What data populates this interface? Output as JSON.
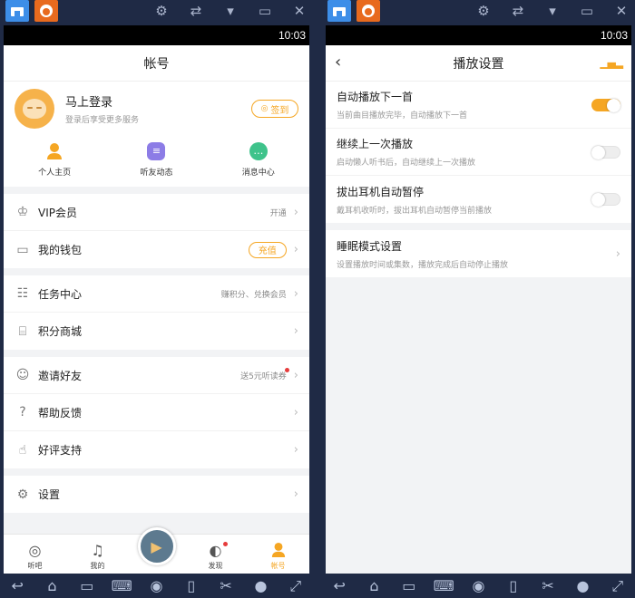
{
  "status_time": "10:03",
  "account": {
    "title": "帐号",
    "login_label": "马上登录",
    "login_sub": "登录后享受更多服务",
    "signin_label": "签到",
    "shortcuts": [
      {
        "label": "个人主页"
      },
      {
        "label": "听友动态"
      },
      {
        "label": "消息中心"
      }
    ],
    "menu": {
      "vip": {
        "label": "VIP会员",
        "value": "开通"
      },
      "wallet": {
        "label": "我的钱包",
        "pill": "充值"
      },
      "tasks": {
        "label": "任务中心",
        "value": "赚积分、兑换会员"
      },
      "points_mall": {
        "label": "积分商城"
      },
      "invite": {
        "label": "邀请好友",
        "value": "送5元听读券"
      },
      "help": {
        "label": "帮助反馈"
      },
      "rate": {
        "label": "好评支持"
      },
      "settings": {
        "label": "设置"
      }
    },
    "tabs": [
      {
        "label": "听吧"
      },
      {
        "label": "我的"
      },
      {
        "label": "发现"
      },
      {
        "label": "帐号"
      }
    ]
  },
  "playback": {
    "title": "播放设置",
    "settings": [
      {
        "label": "自动播放下一首",
        "desc": "当前曲目播放完毕，自动播放下一首",
        "enabled": true
      },
      {
        "label": "继续上一次播放",
        "desc": "启动懒人听书后，自动继续上一次播放",
        "enabled": false
      },
      {
        "label": "拔出耳机自动暂停",
        "desc": "戴耳机收听时，拔出耳机自动暂停当前播放",
        "enabled": false
      }
    ],
    "sleep": {
      "label": "睡眠模式设置",
      "desc": "设置播放时间或集数，播放完成后自动停止播放"
    }
  },
  "colors": {
    "accent": "#f5a623",
    "badge": "#e63c3c"
  }
}
